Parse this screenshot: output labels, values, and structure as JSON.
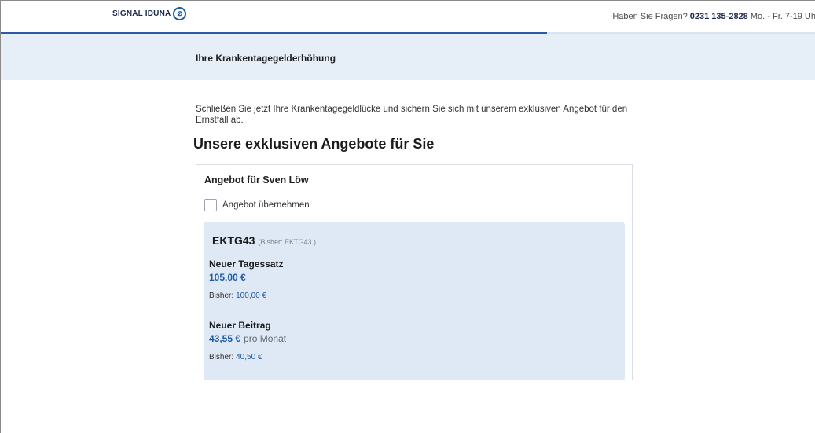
{
  "header": {
    "logo_text": "SIGNAL IDUNA",
    "help_prefix": "Haben Sie Fragen?",
    "phone": "0231 135-2828",
    "hours": "Mo. - Fr. 7-19 Uh"
  },
  "progress": {
    "fraction": 0.67
  },
  "banner": {
    "title": "Ihre Krankentagegelderhöhung"
  },
  "intro_text": "Schließen Sie jetzt Ihre Krankentagegeldlücke und sichern Sie sich mit unserem exklusiven Angebot für den Ernstfall ab.",
  "heading": "Unsere exklusiven Angebote für Sie",
  "offer": {
    "title": "Angebot für Sven Löw",
    "checkbox_label": "Angebot übernehmen",
    "checkbox_checked": false,
    "tariff": {
      "name": "EKTG43",
      "previous": "(Bisher: EKTG43 )"
    },
    "daily_rate": {
      "title": "Neuer Tagessatz",
      "value": "105,00 €",
      "previous_label": "Bisher:",
      "previous_value": "100,00 €"
    },
    "premium": {
      "title": "Neuer Beitrag",
      "value": "43,55 €",
      "unit": "pro Monat",
      "previous_label": "Bisher:",
      "previous_value": "40,50 €"
    }
  },
  "colors": {
    "brand_blue": "#1c5aa6",
    "banner_bg": "#e6eef8",
    "offer_bg": "#dfe8f5"
  }
}
